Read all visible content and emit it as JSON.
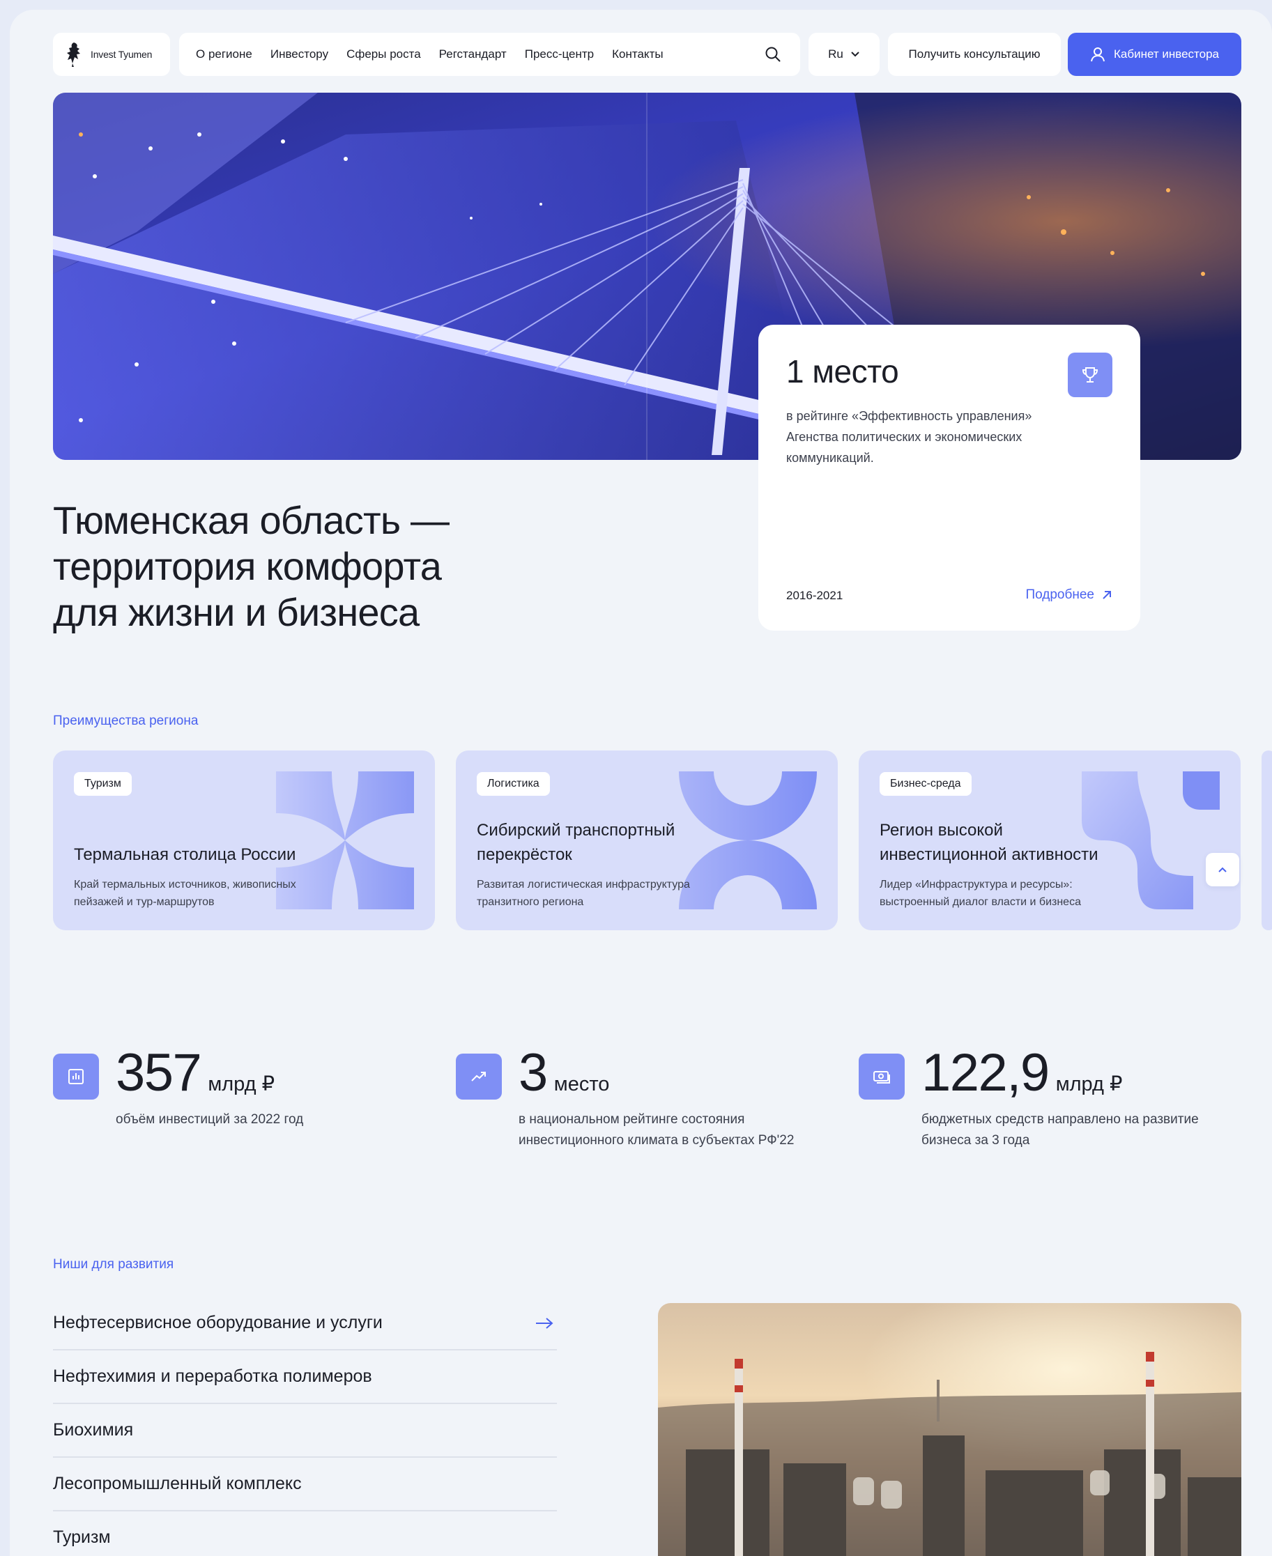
{
  "header": {
    "logo_text": "Invest Tyumen",
    "nav": [
      "О регионе",
      "Инвестору",
      "Сферы роста",
      "Регстандарт",
      "Пресс-центр",
      "Контакты"
    ],
    "language": "Ru",
    "consult_label": "Получить консультацию",
    "cabinet_label": "Кабинет инвестора"
  },
  "award": {
    "rank": "1 место",
    "description": "в рейтинге «Эффективность управления» Агенства политических и экономических коммуникаций.",
    "years": "2016-2021",
    "more_label": "Подробнее"
  },
  "hero": {
    "title_lines": [
      "Тюменская область —",
      "территория комфорта",
      "для жизни и бизнеса"
    ]
  },
  "advantages": {
    "label": "Преимущества региона",
    "cards": [
      {
        "tag": "Туризм",
        "title": "Термальная столица России",
        "desc": "Край термальных источников, живописных пейзажей и тур-маршрутов"
      },
      {
        "tag": "Логистика",
        "title": "Сибирский транспортный перекрёсток",
        "desc": "Развитая логистическая инфраструктура транзитного региона"
      },
      {
        "tag": "Бизнес-среда",
        "title": "Регион высокой инвестиционной активности",
        "desc": "Лидер «Инфраструктура и ресурсы»: выстроенный диалог власти и бизнеса"
      }
    ]
  },
  "stats": [
    {
      "icon": "bar-chart-icon",
      "value": "357",
      "unit": "млрд ₽",
      "desc": "объём инвестиций за 2022 год"
    },
    {
      "icon": "trend-up-icon",
      "value": "3",
      "unit": "место",
      "desc": "в национальном рейтинге состояния инвестиционного климата в субъектах РФ'22"
    },
    {
      "icon": "money-icon",
      "value": "122,9",
      "unit": "млрд ₽",
      "desc": "бюджетных средств направлено на развитие бизнеса за 3 года"
    }
  ],
  "niches": {
    "label": "Ниши для развития",
    "items": [
      "Нефтесервисное оборудование и услуги",
      "Нефтехимия и переработка полимеров",
      "Биохимия",
      "Лесопромышленный комплекс",
      "Туризм"
    ]
  },
  "colors": {
    "accent": "#4a62ef",
    "icon_tile": "#7f8ff5",
    "card_bg": "#d8ddfa",
    "page_bg": "#f1f4f9"
  }
}
